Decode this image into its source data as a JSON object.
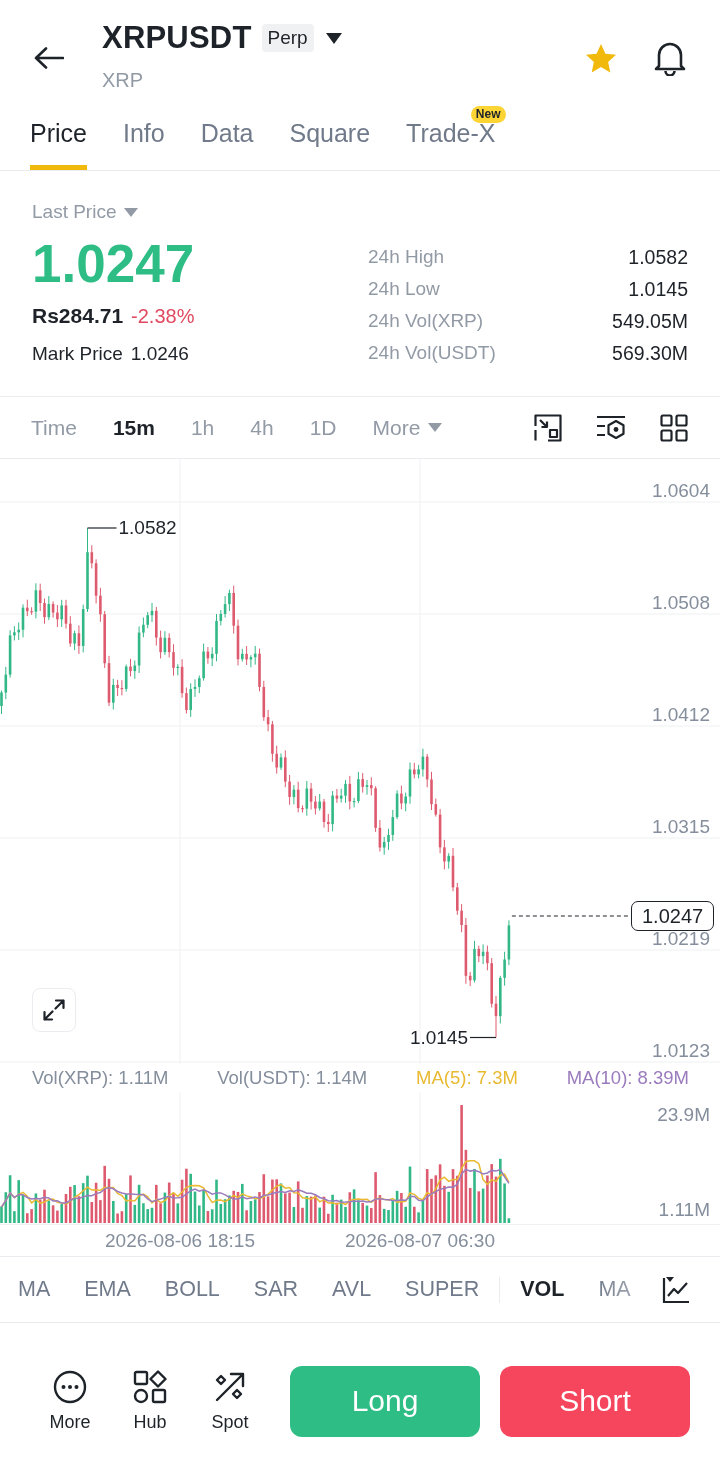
{
  "header": {
    "title": "XRPUSDT",
    "badge": "Perp",
    "subtitle": "XRP",
    "favorite": true
  },
  "tabs": [
    {
      "label": "Price",
      "selected": true
    },
    {
      "label": "Info",
      "selected": false
    },
    {
      "label": "Data",
      "selected": false
    },
    {
      "label": "Square",
      "selected": false
    },
    {
      "label": "Trade-X",
      "selected": false,
      "badge": "New"
    }
  ],
  "ticker": {
    "price_type": "Last Price",
    "last_price": "1.0247",
    "fiat_price": "Rs284.71",
    "change": "-2.38%",
    "mark_price_label": "Mark Price",
    "mark_price": "1.0246",
    "stats": [
      {
        "label": "24h High",
        "value": "1.0582"
      },
      {
        "label": "24h Low",
        "value": "1.0145"
      },
      {
        "label": "24h Vol(XRP)",
        "value": "549.05M"
      },
      {
        "label": "24h Vol(USDT)",
        "value": "569.30M"
      }
    ]
  },
  "intervals": [
    {
      "label": "Time",
      "selected": false
    },
    {
      "label": "15m",
      "selected": true
    },
    {
      "label": "1h",
      "selected": false
    },
    {
      "label": "4h",
      "selected": false
    },
    {
      "label": "1D",
      "selected": false
    },
    {
      "label": "More",
      "selected": false,
      "dropdown": true
    }
  ],
  "price_chart": {
    "axis_labels": [
      "1.0604",
      "1.0508",
      "1.0412",
      "1.0315",
      "1.0219",
      "1.0123"
    ],
    "high_label": "1.0582",
    "low_label": "1.0145",
    "last_price_tag": "1.0247"
  },
  "volume_legend": [
    {
      "label": "Vol(XRP): 1.11M",
      "color": "#848e9c"
    },
    {
      "label": "Vol(USDT): 1.14M",
      "color": "#848e9c"
    },
    {
      "label": "MA(5): 7.3M",
      "color": "#e8b931"
    },
    {
      "label": "MA(10): 8.39M",
      "color": "#9a7bbd"
    }
  ],
  "volume_chart": {
    "axis_labels": [
      "23.9M",
      "1.11M"
    ]
  },
  "time_axis": [
    "2026-08-06 18:15",
    "2026-08-07 06:30"
  ],
  "main_indicators": [
    {
      "label": "MA",
      "selected": false
    },
    {
      "label": "EMA",
      "selected": false
    },
    {
      "label": "BOLL",
      "selected": false
    },
    {
      "label": "SAR",
      "selected": false
    },
    {
      "label": "AVL",
      "selected": false
    },
    {
      "label": "SUPER",
      "selected": false
    }
  ],
  "sub_indicators": [
    {
      "label": "VOL",
      "selected": true
    },
    {
      "label": "MA",
      "selected": false
    }
  ],
  "bottom_bar": {
    "actions": [
      "More",
      "Hub",
      "Spot"
    ],
    "long": "Long",
    "short": "Short"
  }
}
